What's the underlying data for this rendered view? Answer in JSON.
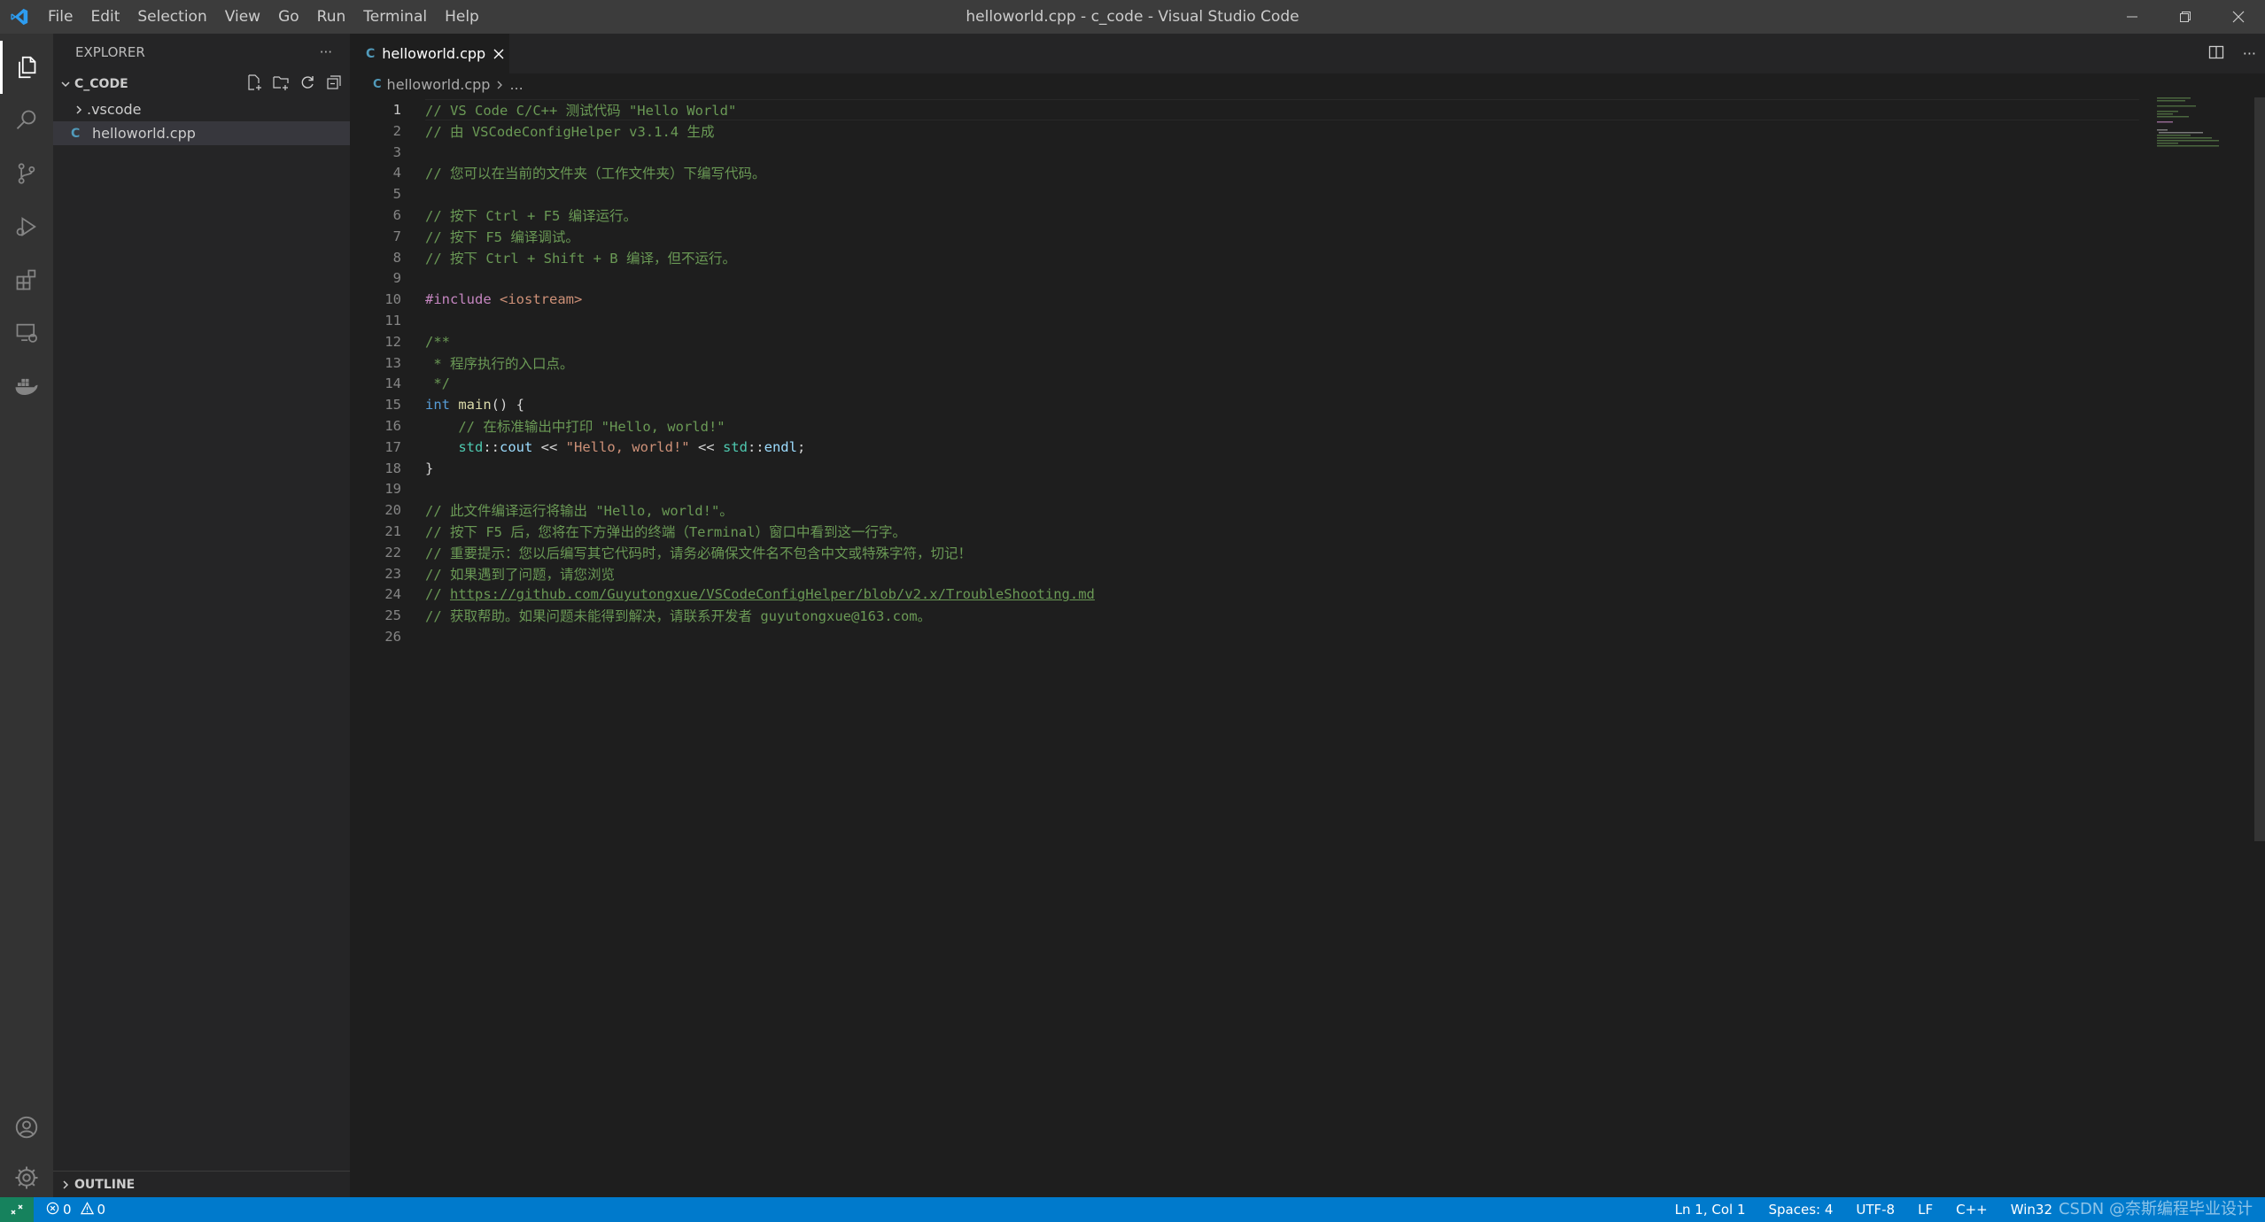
{
  "window": {
    "title": "helloworld.cpp - c_code - Visual Studio Code",
    "menu": [
      "File",
      "Edit",
      "Selection",
      "View",
      "Go",
      "Run",
      "Terminal",
      "Help"
    ]
  },
  "sidebar": {
    "header": "EXPLORER",
    "more": "···",
    "folder": "C_CODE",
    "items": [
      {
        "label": ".vscode",
        "type": "folder"
      },
      {
        "label": "helloworld.cpp",
        "type": "file"
      }
    ],
    "outline": "OUTLINE"
  },
  "editor": {
    "tab_label": "helloworld.cpp",
    "breadcrumb_file": "helloworld.cpp",
    "breadcrumb_more": "...",
    "current_line": 1
  },
  "code_lines": [
    [
      {
        "t": "// VS Code C/C++ 测试代码 \"Hello World\"",
        "c": "cmt"
      }
    ],
    [
      {
        "t": "// 由 VSCodeConfigHelper v3.1.4 生成",
        "c": "cmt"
      }
    ],
    [],
    [
      {
        "t": "// 您可以在当前的文件夹（工作文件夹）下编写代码。",
        "c": "cmt"
      }
    ],
    [],
    [
      {
        "t": "// 按下 Ctrl + F5 编译运行。",
        "c": "cmt"
      }
    ],
    [
      {
        "t": "// 按下 F5 编译调试。",
        "c": "cmt"
      }
    ],
    [
      {
        "t": "// 按下 Ctrl + Shift + B 编译，但不运行。",
        "c": "cmt"
      }
    ],
    [],
    [
      {
        "t": "#include ",
        "c": "pp"
      },
      {
        "t": "<iostream>",
        "c": "str"
      }
    ],
    [],
    [
      {
        "t": "/**",
        "c": "cmt"
      }
    ],
    [
      {
        "t": " * 程序执行的入口点。",
        "c": "cmt"
      }
    ],
    [
      {
        "t": " */",
        "c": "cmt"
      }
    ],
    [
      {
        "t": "int",
        "c": "kw"
      },
      {
        "t": " ",
        "c": "plain"
      },
      {
        "t": "main",
        "c": "fn"
      },
      {
        "t": "() {",
        "c": "plain"
      }
    ],
    [
      {
        "t": "    // 在标准输出中打印 \"Hello, world!\"",
        "c": "cmt"
      }
    ],
    [
      {
        "t": "    ",
        "c": "plain"
      },
      {
        "t": "std",
        "c": "ns"
      },
      {
        "t": "::",
        "c": "plain"
      },
      {
        "t": "cout",
        "c": "ident"
      },
      {
        "t": " << ",
        "c": "plain"
      },
      {
        "t": "\"Hello, world!\"",
        "c": "str"
      },
      {
        "t": " << ",
        "c": "plain"
      },
      {
        "t": "std",
        "c": "ns"
      },
      {
        "t": "::",
        "c": "plain"
      },
      {
        "t": "endl",
        "c": "ident"
      },
      {
        "t": ";",
        "c": "plain"
      }
    ],
    [
      {
        "t": "}",
        "c": "plain"
      }
    ],
    [],
    [
      {
        "t": "// 此文件编译运行将输出 \"Hello, world!\"。",
        "c": "cmt"
      }
    ],
    [
      {
        "t": "// 按下 F5 后，您将在下方弹出的终端（Terminal）窗口中看到这一行字。",
        "c": "cmt"
      }
    ],
    [
      {
        "t": "// 重要提示：您以后编写其它代码时，请务必确保文件名不包含中文或特殊字符，切记！",
        "c": "cmt"
      }
    ],
    [
      {
        "t": "// 如果遇到了问题，请您浏览",
        "c": "cmt"
      }
    ],
    [
      {
        "t": "// ",
        "c": "cmt"
      },
      {
        "t": "https://github.com/Guyutongxue/VSCodeConfigHelper/blob/v2.x/TroubleShooting.md",
        "c": "link"
      }
    ],
    [
      {
        "t": "// 获取帮助。如果问题未能得到解决，请联系开发者 guyutongxue@163.com。",
        "c": "cmt"
      }
    ],
    []
  ],
  "status": {
    "errors": "0",
    "warnings": "0",
    "position": "Ln 1, Col 1",
    "spaces": "Spaces: 4",
    "encoding": "UTF-8",
    "eol": "LF",
    "language": "C++",
    "platform": "Win32",
    "watermark": "CSDN @奈斯编程毕业设计"
  },
  "colors": {
    "accent": "#007acc",
    "comment": "#6a9955",
    "keyword": "#569cd6",
    "string": "#ce9178"
  }
}
